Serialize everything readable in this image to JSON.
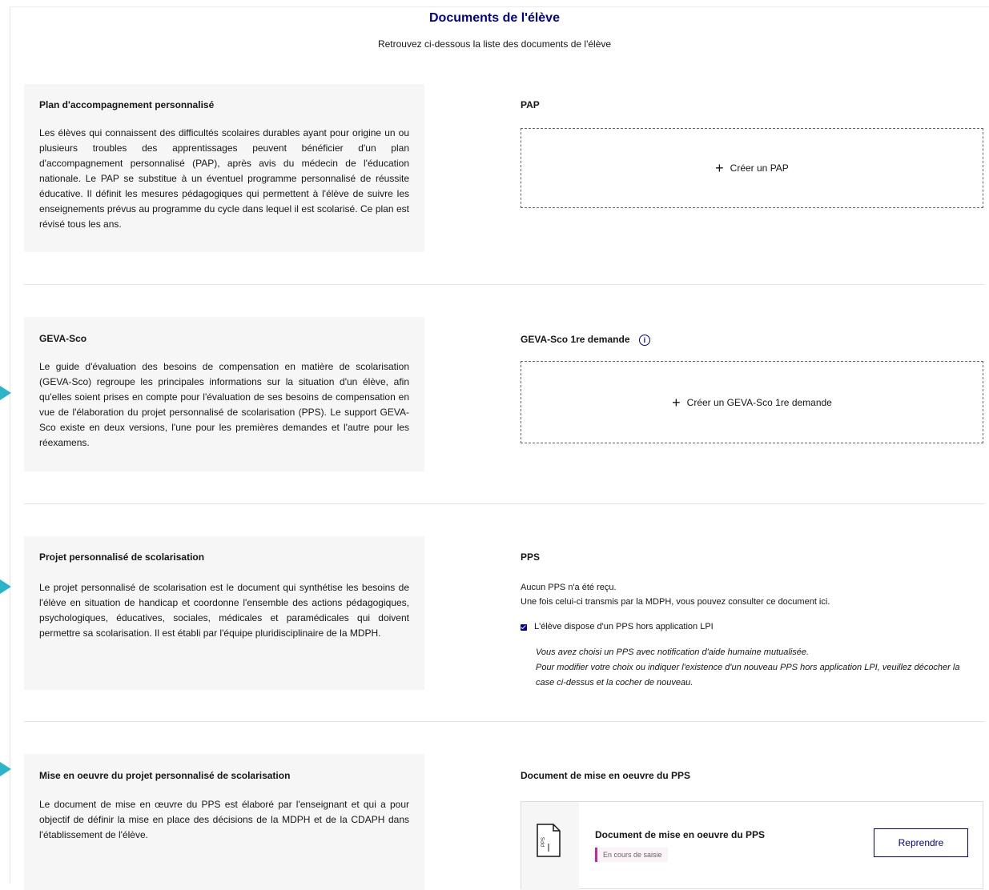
{
  "header": {
    "title": "Documents de l'élève",
    "subtitle": "Retrouvez ci-dessous la liste des documents de l'élève"
  },
  "sections": {
    "pap": {
      "desc_title": "Plan d'accompagnement personnalisé",
      "desc_text": "Les élèves qui connaissent des difficultés scolaires durables ayant pour origine un ou plusieurs troubles des apprentissages peuvent bénéficier d'un plan d'accompagnement personnalisé (PAP), après avis du médecin de l'éducation nationale. Le PAP se substitue à un éventuel programme personnalisé de réussite éducative. Il définit les mesures pédagogiques qui permettent à l'élève de suivre les enseignements prévus au programme du cycle dans lequel il est scolarisé. Ce plan est révisé tous les ans.",
      "right_title": "PAP",
      "create_label": "Créer un PAP"
    },
    "geva": {
      "desc_title": "GEVA-Sco",
      "desc_text": "Le guide d'évaluation des besoins de compensation en matière de scolarisation (GEVA-Sco) regroupe les principales informations sur la situation d'un élève, afin qu'elles soient prises en compte pour l'évaluation de ses besoins de compensation en vue de l'élaboration du projet personnalisé de scolarisation (PPS). Le support GEVA-Sco existe en deux versions, l'une pour les premières demandes et l'autre pour les réexamens.",
      "right_title": "GEVA-Sco 1re demande",
      "info_icon": "i",
      "create_label": "Créer un GEVA-Sco 1re demande"
    },
    "pps": {
      "desc_title": "Projet personnalisé de scolarisation",
      "desc_text": "Le projet personnalisé de scolarisation est le document qui synthétise les besoins de l'élève en situation de handicap et coordonne l'ensemble des actions pédagogiques, psychologiques, éducatives, sociales, médicales et paramédicales qui doivent permettre sa scolarisation. Il est établi par l'équipe pluridisciplinaire de la MDPH.",
      "right_title": "PPS",
      "line1": "Aucun PPS n'a été reçu.",
      "line2": "Une fois celui-ci transmis par la MDPH, vous pouvez consulter ce document ici.",
      "checkbox_label": "L'élève dispose d'un PPS hors application LPI",
      "italic1": "Vous avez choisi un PPS avec notification d'aide humaine mutualisée.",
      "italic2": "Pour modifier votre choix ou indiquer l'existence d'un nouveau PPS hors application LPI, veuillez décocher la case ci-dessus et la cocher de nouveau."
    },
    "mise": {
      "desc_title": "Mise en oeuvre du projet personnalisé de scolarisation",
      "desc_text": "Le document de mise en œuvre du PPS est élaboré par l'enseignant et qui a pour objectif de définir la mise en place des décisions de la MDPH et de la CDAPH dans l'établissement de l'élève.",
      "right_title": "Document de mise en oeuvre du PPS",
      "card_title": "Document de mise en oeuvre du PPS",
      "badge": "En cours de saisie",
      "icon_label": "PPS",
      "button": "Reprendre"
    }
  }
}
